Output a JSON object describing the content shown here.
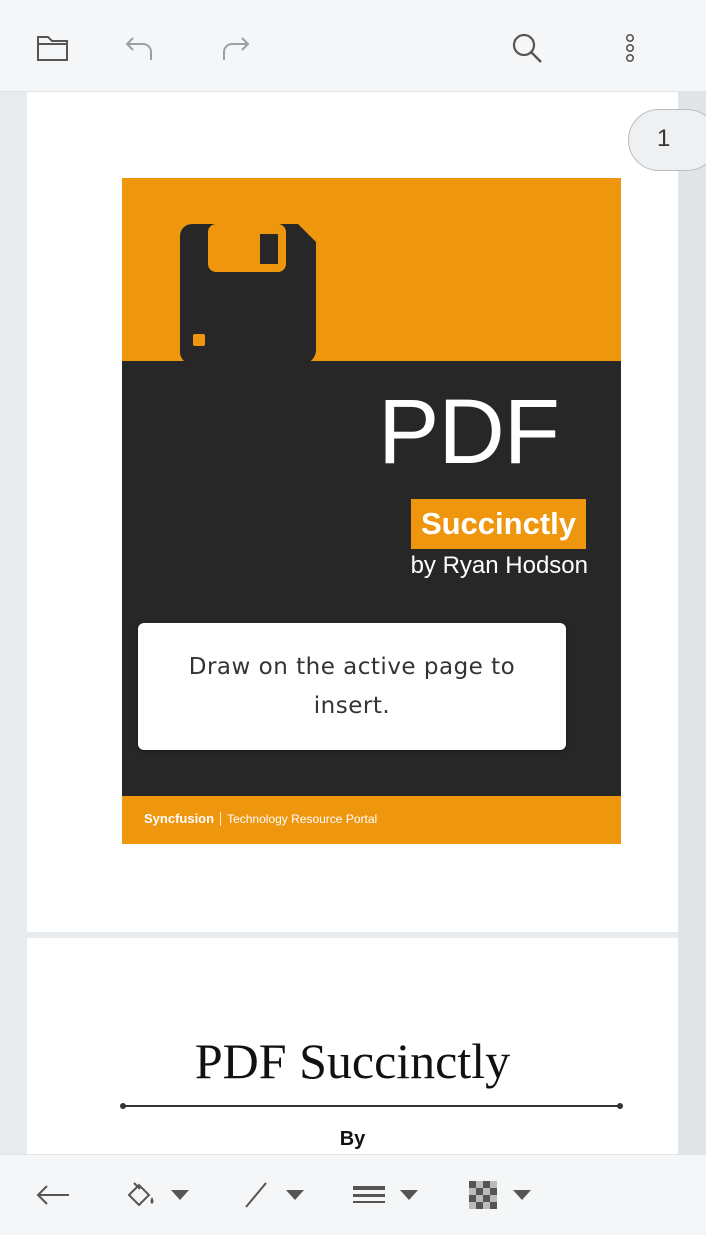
{
  "toolbar": {
    "open_icon": "folder-icon",
    "undo_icon": "undo-icon",
    "redo_icon": "redo-icon",
    "search_icon": "search-icon",
    "more_icon": "more-vertical-icon"
  },
  "page_indicator": "1",
  "cover": {
    "title": "PDF",
    "series": "Succinctly",
    "author": "by Ryan Hodson",
    "brand": "Syncfusion",
    "tagline": "Technology Resource Portal",
    "accent_color": "#ef960f",
    "dark_color": "#272727"
  },
  "toast": {
    "message": "Draw on the active page to insert."
  },
  "page2": {
    "title": "PDF Succinctly",
    "by": "By"
  },
  "bottom_toolbar": {
    "back_icon": "arrow-left-icon",
    "fill_icon": "fill-bucket-icon",
    "stroke_icon": "line-stroke-icon",
    "thickness_icon": "line-thickness-icon",
    "opacity_icon": "opacity-checker-icon"
  }
}
